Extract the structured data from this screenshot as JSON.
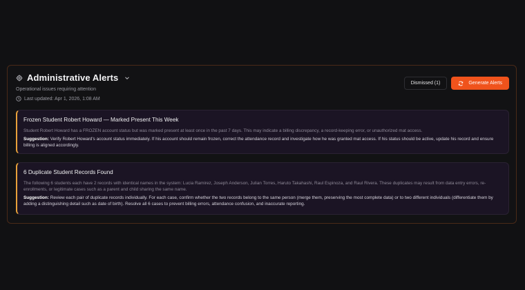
{
  "header": {
    "title": "Administrative Alerts",
    "subtitle": "Operational issues requiring attention",
    "last_updated": "Last updated: Apr 1, 2026, 1:08 AM"
  },
  "actions": {
    "dismissed_label": "Dismissed (1)",
    "generate_label": "Generate Alerts"
  },
  "alerts": [
    {
      "title": "Frozen Student Robert Howard — Marked Present This Week",
      "description": "Student Robert Howard has a FROZEN account status but was marked present at least once in the past 7 days. This may indicate a billing discrepancy, a record-keeping error, or unauthorized mat access.",
      "suggestion_label": "Suggestion:",
      "suggestion": "Verify Robert Howard's account status immediately. If his account should remain frozen, correct the attendance record and investigate how he was granted mat access. If his status should be active, update his record and ensure billing is aligned accordingly."
    },
    {
      "title": "6 Duplicate Student Records Found",
      "description": "The following 6 students each have 2 records with identical names in the system: Lucia Ramirez, Joseph Anderson, Julian Torres, Haruto Takahashi, Raul Espinoza, and Raul Rivera. These duplicates may result from data entry errors, re-enrollments, or legitimate cases such as a parent and child sharing the same name.",
      "suggestion_label": "Suggestion:",
      "suggestion": "Review each pair of duplicate records individually. For each case, confirm whether the two records belong to the same person (merge them, preserving the most complete data) or to two different individuals (differentiate them by adding a distinguishing detail such as date of birth). Resolve all 6 cases to prevent billing errors, attendance confusion, and inaccurate reporting."
    }
  ],
  "colors": {
    "accent": "#f0531c",
    "warning_border": "#e9a23b",
    "card_bg": "#1b1424",
    "page_bg": "#111113"
  }
}
